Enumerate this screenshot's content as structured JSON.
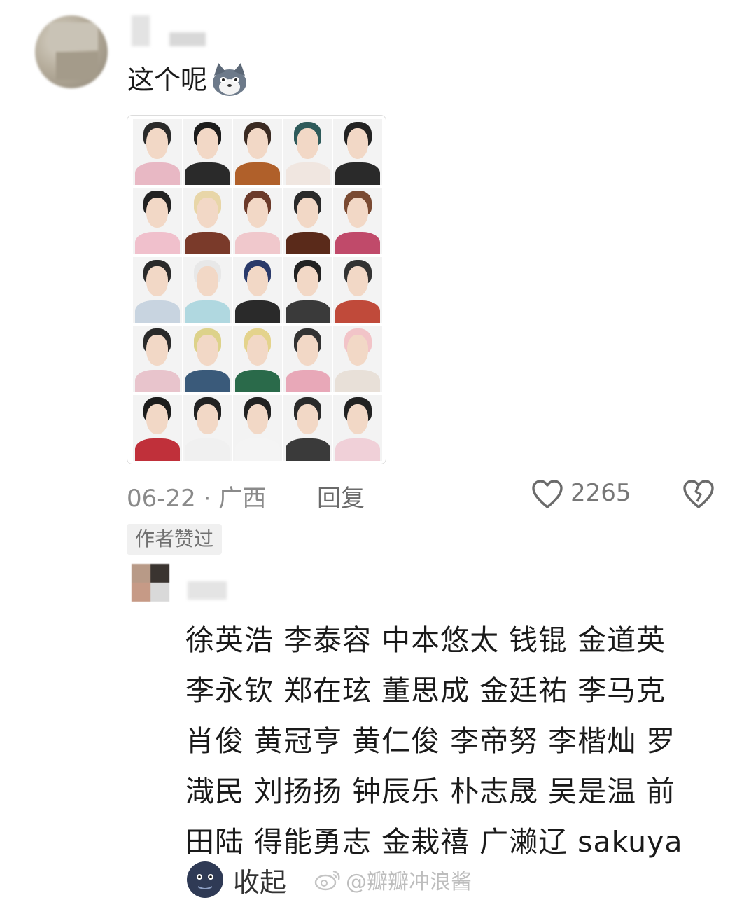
{
  "comment": {
    "text": "这个呢",
    "emoji": "wolf-face-emoji",
    "grid_photos": 25
  },
  "meta": {
    "date_location": "06-22 · 广西",
    "reply_label": "回复",
    "like_count": "2265"
  },
  "author_badge": "作者赞过",
  "reply": {
    "lines": [
      "徐英浩 李泰容 中本悠太 钱锟 金道英",
      "李永钦 郑在玹 董思成 金廷祐 李马克",
      "肖俊 黄冠亨 黄仁俊 李帝努 李楷灿 罗",
      "渽民 刘扬扬 钟辰乐 朴志晟 吴是温 前",
      "田陆 得能勇志 金栽禧 广濑辽 sakuya"
    ]
  },
  "collapse_label": "收起",
  "watermark": "@瓣瓣冲浪酱",
  "colors": {
    "text": "#1a1a1a",
    "meta": "#8a8a8a",
    "badge_bg": "#f0f0f0"
  }
}
